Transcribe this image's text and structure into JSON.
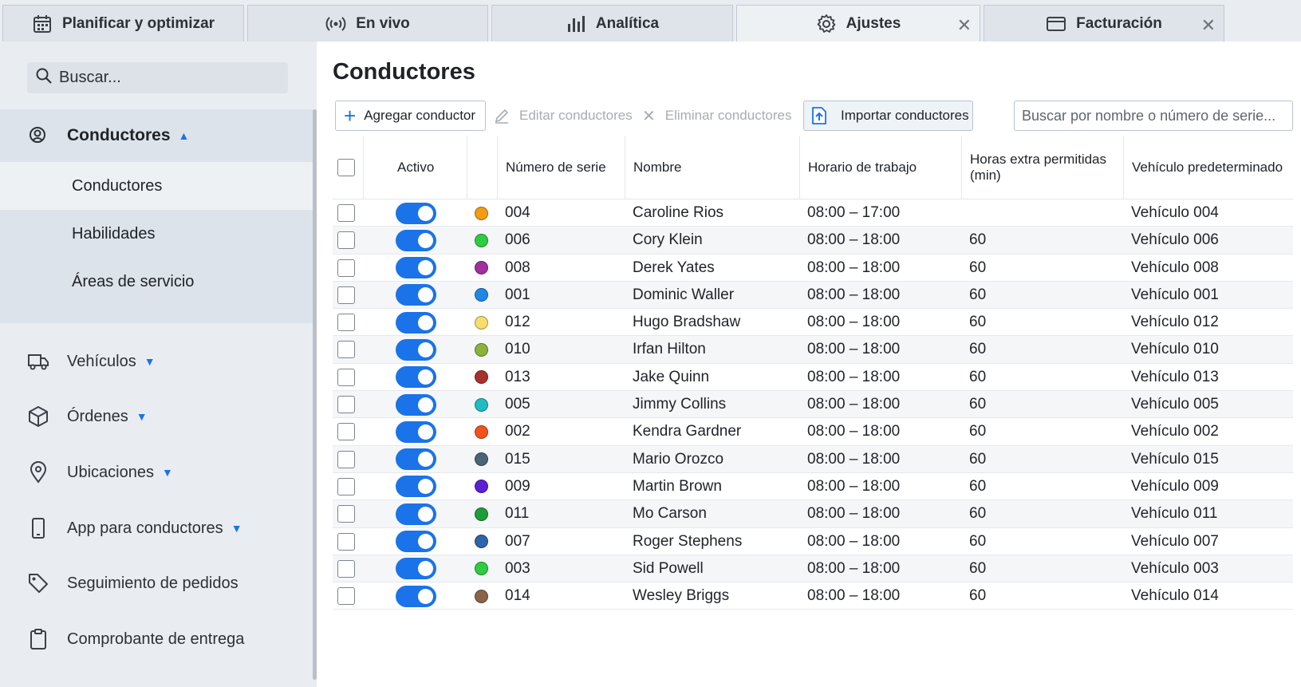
{
  "tabs": [
    {
      "label": "Planificar y optimizar",
      "icon": "calendar-icon",
      "closable": false,
      "active": false
    },
    {
      "label": "En vivo",
      "icon": "broadcast-icon",
      "closable": false,
      "active": false
    },
    {
      "label": "Analítica",
      "icon": "bar-chart-icon",
      "closable": false,
      "active": false
    },
    {
      "label": "Ajustes",
      "icon": "gear-icon",
      "closable": true,
      "active": true
    },
    {
      "label": "Facturación",
      "icon": "credit-card-icon",
      "closable": true,
      "active": false
    }
  ],
  "sidebar": {
    "search_placeholder": "Buscar...",
    "group": {
      "label": "Conductores",
      "icon": "drivers-icon",
      "items": [
        {
          "label": "Conductores",
          "active": true
        },
        {
          "label": "Habilidades",
          "active": false
        },
        {
          "label": "Áreas de servicio",
          "active": false
        }
      ]
    },
    "nav": [
      {
        "label": "Vehículos",
        "icon": "truck-icon",
        "caret": true
      },
      {
        "label": "Órdenes",
        "icon": "package-icon",
        "caret": true
      },
      {
        "label": "Ubicaciones",
        "icon": "location-pin-icon",
        "caret": true
      },
      {
        "label": "App para conductores",
        "icon": "phone-icon",
        "caret": true
      },
      {
        "label": "Seguimiento de pedidos",
        "icon": "tag-icon",
        "caret": false
      },
      {
        "label": "Comprobante de entrega",
        "icon": "clipboard-icon",
        "caret": false
      }
    ]
  },
  "main": {
    "title": "Conductores",
    "toolbar": {
      "add_label": "Agregar conductor",
      "edit_label": "Editar conductores",
      "delete_label": "Eliminar conductores",
      "import_label": "Importar conductores",
      "search_placeholder": "Buscar por nombre o número de serie..."
    },
    "columns": [
      "Activo",
      "Número de serie",
      "Nombre",
      "Horario de trabajo",
      "Horas extra permitidas (min)",
      "Vehículo predeterminado"
    ],
    "rows": [
      {
        "color": "#f39c12",
        "serial": "004",
        "name": "Caroline Rios",
        "schedule": "08:00 – 17:00",
        "overtime": "",
        "vehicle": "Vehículo 004"
      },
      {
        "color": "#2ecc40",
        "serial": "006",
        "name": "Cory Klein",
        "schedule": "08:00 – 18:00",
        "overtime": "60",
        "vehicle": "Vehículo 006"
      },
      {
        "color": "#a0309a",
        "serial": "008",
        "name": "Derek Yates",
        "schedule": "08:00 – 18:00",
        "overtime": "60",
        "vehicle": "Vehículo 008"
      },
      {
        "color": "#1e88e5",
        "serial": "001",
        "name": "Dominic Waller",
        "schedule": "08:00 – 18:00",
        "overtime": "60",
        "vehicle": "Vehículo 001"
      },
      {
        "color": "#f7dc6f",
        "serial": "012",
        "name": "Hugo Bradshaw",
        "schedule": "08:00 – 18:00",
        "overtime": "60",
        "vehicle": "Vehículo 012"
      },
      {
        "color": "#8bb33a",
        "serial": "010",
        "name": "Irfan Hilton",
        "schedule": "08:00 – 18:00",
        "overtime": "60",
        "vehicle": "Vehículo 010"
      },
      {
        "color": "#a8322b",
        "serial": "013",
        "name": "Jake Quinn",
        "schedule": "08:00 – 18:00",
        "overtime": "60",
        "vehicle": "Vehículo 013"
      },
      {
        "color": "#1fbcc4",
        "serial": "005",
        "name": "Jimmy Collins",
        "schedule": "08:00 – 18:00",
        "overtime": "60",
        "vehicle": "Vehículo 005"
      },
      {
        "color": "#f2521c",
        "serial": "002",
        "name": "Kendra Gardner",
        "schedule": "08:00 – 18:00",
        "overtime": "60",
        "vehicle": "Vehículo 002"
      },
      {
        "color": "#4a6478",
        "serial": "015",
        "name": "Mario Orozco",
        "schedule": "08:00 – 18:00",
        "overtime": "60",
        "vehicle": "Vehículo 015"
      },
      {
        "color": "#5b21d6",
        "serial": "009",
        "name": "Martin Brown",
        "schedule": "08:00 – 18:00",
        "overtime": "60",
        "vehicle": "Vehículo 009"
      },
      {
        "color": "#1e9e3a",
        "serial": "011",
        "name": "Mo Carson",
        "schedule": "08:00 – 18:00",
        "overtime": "60",
        "vehicle": "Vehículo 011"
      },
      {
        "color": "#2e64a8",
        "serial": "007",
        "name": "Roger Stephens",
        "schedule": "08:00 – 18:00",
        "overtime": "60",
        "vehicle": "Vehículo 007"
      },
      {
        "color": "#2ecc40",
        "serial": "003",
        "name": "Sid Powell",
        "schedule": "08:00 – 18:00",
        "overtime": "60",
        "vehicle": "Vehículo 003"
      },
      {
        "color": "#8a6446",
        "serial": "014",
        "name": "Wesley Briggs",
        "schedule": "08:00 – 18:00",
        "overtime": "60",
        "vehicle": "Vehículo 014"
      }
    ]
  },
  "colors": {
    "accent": "#1a73e8"
  }
}
